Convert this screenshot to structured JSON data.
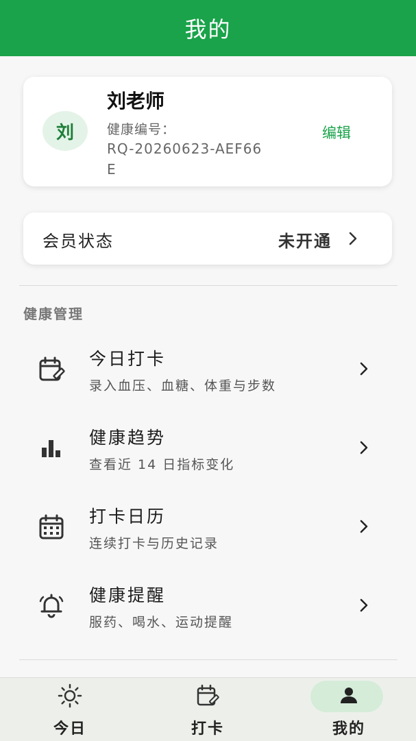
{
  "header": {
    "title": "我的"
  },
  "profile": {
    "avatar_text": "刘",
    "name": "刘老师",
    "id_label": "健康编号：",
    "id_value": "RQ-20260623-AEF66E",
    "edit_label": "编辑"
  },
  "membership": {
    "label": "会员状态",
    "status": "未开通",
    "chevron_icon": "chevron-right-icon"
  },
  "health_section": {
    "title": "健康管理",
    "items": [
      {
        "title": "今日打卡",
        "subtitle": "录入血压、血糖、体重与步数",
        "icon": "calendar-edit-icon"
      },
      {
        "title": "健康趋势",
        "subtitle": "查看近 14 日指标变化",
        "icon": "bar-chart-icon"
      },
      {
        "title": "打卡日历",
        "subtitle": "连续打卡与历史记录",
        "icon": "calendar-icon"
      },
      {
        "title": "健康提醒",
        "subtitle": "服药、喝水、运动提醒",
        "icon": "bell-icon"
      }
    ]
  },
  "bottom_nav": {
    "items": [
      {
        "label": "今日",
        "icon": "sun-icon",
        "active": false
      },
      {
        "label": "打卡",
        "icon": "calendar-edit-icon",
        "active": false
      },
      {
        "label": "我的",
        "icon": "person-icon",
        "active": true
      }
    ]
  },
  "colors": {
    "brand_green": "#1aa34a",
    "avatar_bg": "#e4f3e8",
    "active_tab_bg": "#d5ecd9",
    "nav_bg": "#edf0ea"
  }
}
